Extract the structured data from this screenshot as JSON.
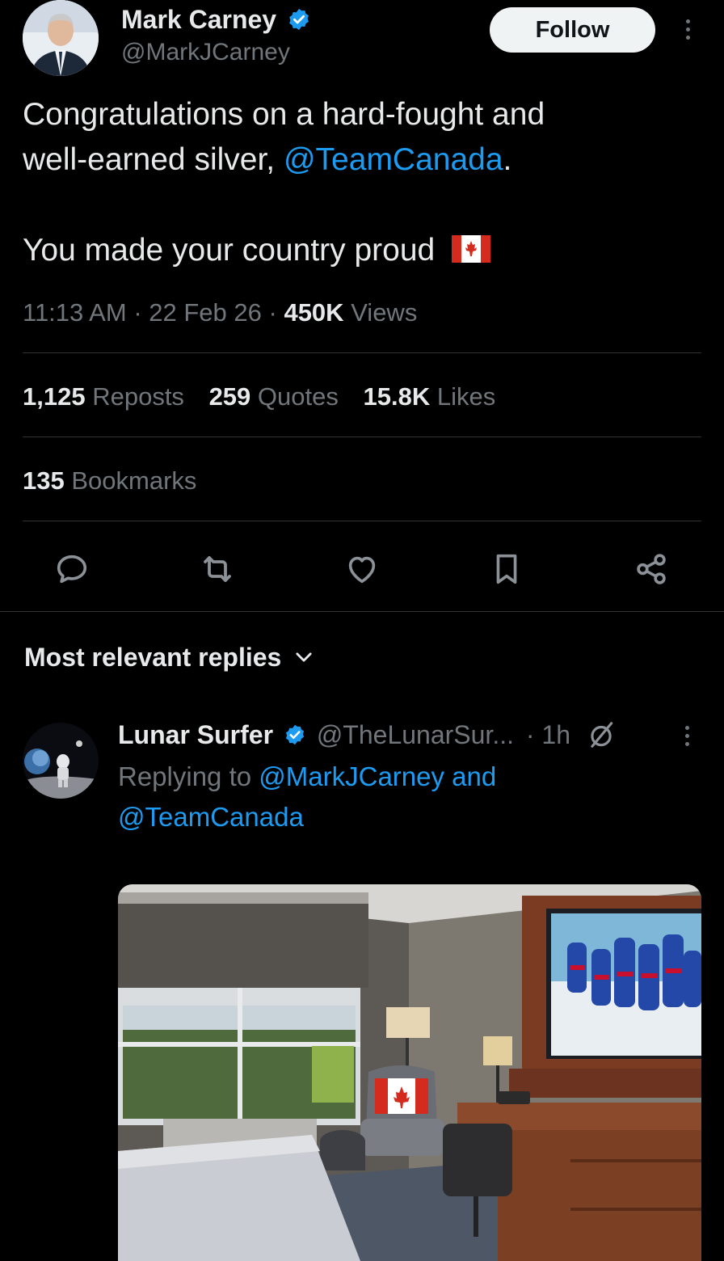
{
  "tweet": {
    "author_name": "Mark Carney",
    "author_handle": "@MarkJCarney",
    "follow_label": "Follow",
    "text_line1": "Congratulations on a hard-fought and",
    "text_line2_prefix": "well-earned silver, ",
    "text_line2_mention": "@TeamCanada",
    "text_line2_suffix": ".",
    "text_line3": "You made your country proud",
    "time": "11:13 AM",
    "date": "22 Feb 26",
    "sep": "·",
    "views_count": "450K",
    "views_label": "Views",
    "reposts_count": "1,125",
    "reposts_label": "Reposts",
    "quotes_count": "259",
    "quotes_label": "Quotes",
    "likes_count": "15.8K",
    "likes_label": "Likes",
    "bookmarks_count": "135",
    "bookmarks_label": "Bookmarks"
  },
  "actions": [
    "reply-icon",
    "repost-icon",
    "like-icon",
    "bookmark-icon",
    "share-icon"
  ],
  "replies_header": "Most relevant replies",
  "reply": {
    "author_name": "Lunar Surfer",
    "author_handle": "@TheLunarSur...",
    "time": "· 1h",
    "replying_to_label": "Replying to",
    "replying_to_mentions_line1": "@MarkJCarney and",
    "replying_to_mentions_line2": "@TeamCanada"
  },
  "colors": {
    "background": "#000000",
    "text": "#e7e9ea",
    "muted": "#71767b",
    "accent": "#1d9bf0",
    "divider": "#2f3336"
  }
}
